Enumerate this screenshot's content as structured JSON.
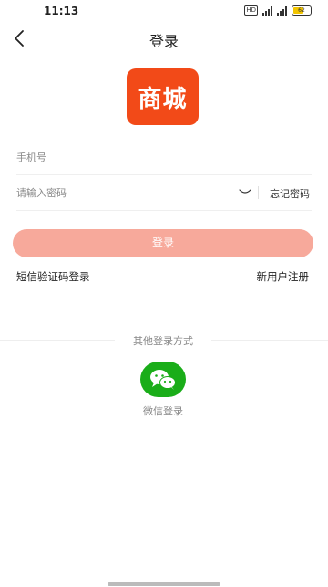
{
  "status_bar": {
    "time": "11:13",
    "hd_label": "HD",
    "network_label": "4G",
    "battery_level": "62",
    "battery_color": "#f2c500"
  },
  "nav": {
    "title": "登录",
    "back_icon": "chevron-left-icon"
  },
  "logo": {
    "text": "商城",
    "color": "#f24a18"
  },
  "form": {
    "phone_placeholder": "手机号",
    "password_placeholder": "请输入密码",
    "forgot_label": "忘记密码",
    "eye_icon": "eye-closed-icon"
  },
  "actions": {
    "login_label": "登录",
    "login_color": "#f7a99b",
    "sms_login_label": "短信验证码登录",
    "register_label": "新用户注册"
  },
  "other_login": {
    "title": "其他登录方式",
    "wechat_label": "微信登录",
    "wechat_icon": "wechat-icon",
    "wechat_color": "#1aad19"
  }
}
